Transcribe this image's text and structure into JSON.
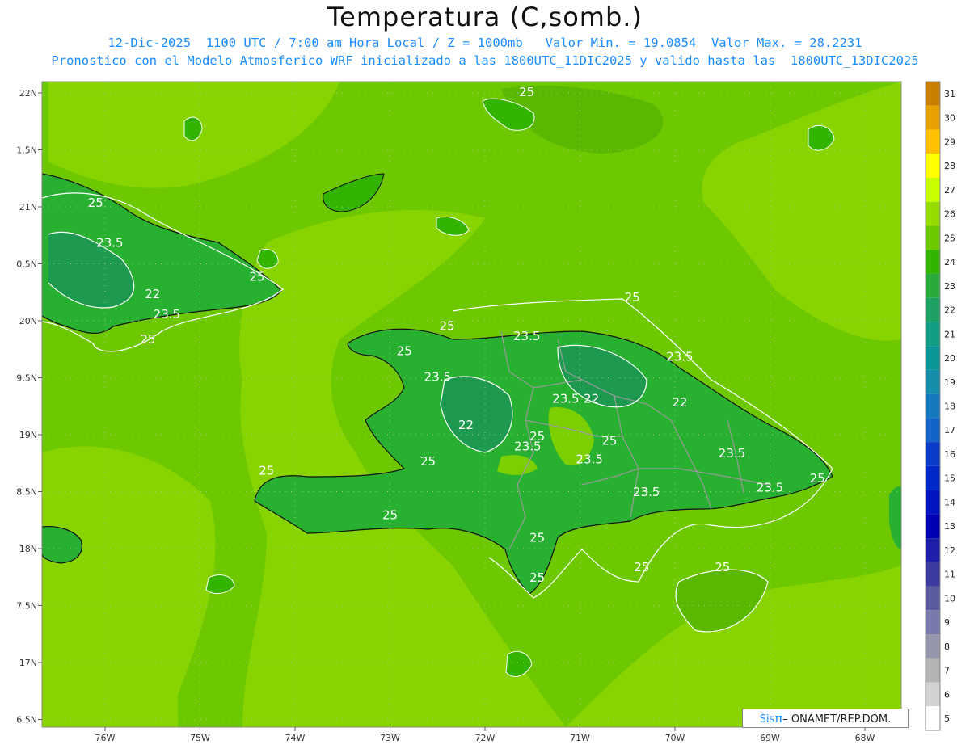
{
  "header": {
    "title": "Temperatura (C,somb.)",
    "subtitle1": "12-Dic-2025  1100 UTC / 7:00 am Hora Local / Z = 1000mb   Valor Min. = 19.0854  Valor Max. = 28.2231",
    "subtitle2": "Pronostico con el Modelo Atmosferico WRF inicializado a las 1800UTC_11DIC2025 y valido hasta las  1800UTC_13DIC2025"
  },
  "map": {
    "lon_labels": [
      "76W",
      "75W",
      "74W",
      "73W",
      "72W",
      "71W",
      "70W",
      "69W",
      "68W"
    ],
    "lat_labels": [
      "22N",
      "1.5N",
      "21N",
      "0.5N",
      "20N",
      "9.5N",
      "19N",
      "8.5N",
      "18N",
      "7.5N",
      "17N",
      "6.5N"
    ],
    "contour_labels": [
      {
        "text": "25",
        "lon": -71.56,
        "lat": 21.97
      },
      {
        "text": "25",
        "lon": -76.1,
        "lat": 21.0
      },
      {
        "text": "23.5",
        "lon": -75.95,
        "lat": 20.65
      },
      {
        "text": "25",
        "lon": -74.4,
        "lat": 20.35
      },
      {
        "text": "22",
        "lon": -75.5,
        "lat": 20.2
      },
      {
        "text": "23.5",
        "lon": -75.35,
        "lat": 20.02
      },
      {
        "text": "25",
        "lon": -75.55,
        "lat": 19.8
      },
      {
        "text": "25",
        "lon": -70.45,
        "lat": 20.17
      },
      {
        "text": "25",
        "lon": -72.4,
        "lat": 19.92
      },
      {
        "text": "23.5",
        "lon": -71.56,
        "lat": 19.83
      },
      {
        "text": "25",
        "lon": -72.85,
        "lat": 19.7
      },
      {
        "text": "23.5",
        "lon": -69.95,
        "lat": 19.65
      },
      {
        "text": "23.5",
        "lon": -72.5,
        "lat": 19.47
      },
      {
        "text": "23.5",
        "lon": -71.15,
        "lat": 19.28
      },
      {
        "text": "22",
        "lon": -70.88,
        "lat": 19.28
      },
      {
        "text": "22",
        "lon": -69.95,
        "lat": 19.25
      },
      {
        "text": "22",
        "lon": -72.2,
        "lat": 19.05
      },
      {
        "text": "25",
        "lon": -71.45,
        "lat": 18.95
      },
      {
        "text": "25",
        "lon": -70.69,
        "lat": 18.91
      },
      {
        "text": "23.5",
        "lon": -71.55,
        "lat": 18.86
      },
      {
        "text": "23.5",
        "lon": -70.9,
        "lat": 18.75
      },
      {
        "text": "23.5",
        "lon": -69.4,
        "lat": 18.8
      },
      {
        "text": "25",
        "lon": -72.6,
        "lat": 18.73
      },
      {
        "text": "25",
        "lon": -74.3,
        "lat": 18.65
      },
      {
        "text": "25",
        "lon": -68.5,
        "lat": 18.58
      },
      {
        "text": "23.5",
        "lon": -69.0,
        "lat": 18.5
      },
      {
        "text": "23.5",
        "lon": -70.3,
        "lat": 18.46
      },
      {
        "text": "25",
        "lon": -73.0,
        "lat": 18.26
      },
      {
        "text": "25",
        "lon": -71.45,
        "lat": 18.06
      },
      {
        "text": "25",
        "lon": -70.35,
        "lat": 17.8
      },
      {
        "text": "25",
        "lon": -69.5,
        "lat": 17.8
      },
      {
        "text": "25",
        "lon": -71.45,
        "lat": 17.71
      }
    ]
  },
  "colorbar": {
    "labels": [
      "31",
      "30",
      "29",
      "28",
      "27",
      "26",
      "25",
      "24",
      "23",
      "22",
      "21",
      "20",
      "19",
      "18",
      "17",
      "16",
      "15",
      "14",
      "13",
      "12",
      "11",
      "10",
      "9",
      "8",
      "7",
      "6",
      "5"
    ],
    "colors": [
      "#c87f00",
      "#e6a000",
      "#ffc000",
      "#ffff00",
      "#c8ff00",
      "#96dc00",
      "#6ec800",
      "#32b400",
      "#28aa3c",
      "#1ea064",
      "#129c82",
      "#0a9696",
      "#148caa",
      "#1478be",
      "#1464c8",
      "#0a3cc8",
      "#0028c8",
      "#0014c0",
      "#0000b4",
      "#1e1eaa",
      "#3c3ca0",
      "#5a5aa0",
      "#7878aa",
      "#9696aa",
      "#b4b4b4",
      "#d2d2d2",
      "#ffffff"
    ]
  },
  "credit": {
    "sis": "Sis",
    "pi": "π",
    "rest": "– ONAMET/REP.DOM."
  }
}
